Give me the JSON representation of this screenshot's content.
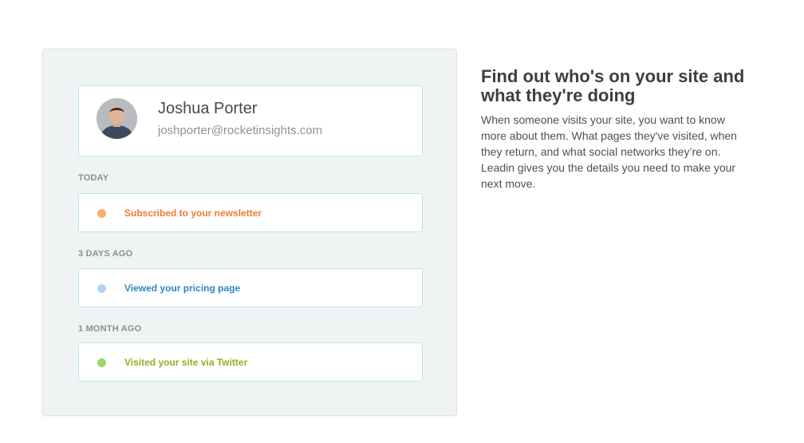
{
  "profile": {
    "name": "Joshua Porter",
    "email": "joshporter@rocketinsights.com"
  },
  "timeline": [
    {
      "label": "TODAY",
      "event": "Subscribed to your newsletter",
      "dot_color": "#f6b26b",
      "text_color": "#f07a2e"
    },
    {
      "label": "3 DAYS AGO",
      "event": "Viewed your pricing page",
      "dot_color": "#b4d3f2",
      "text_color": "#2a87c8"
    },
    {
      "label": "1 MONTH AGO",
      "event": "Visited your site via Twitter",
      "dot_color": "#9ed46a",
      "text_color": "#9aaa22"
    }
  ],
  "info": {
    "heading": "Find out who's on your site and what they're doing",
    "body": "When someone visits your site, you want to know more about them. What pages they've visited, when they return, and what social networks they’re on. Leadin gives you the details you need to make your next move."
  },
  "icons": {
    "avatar": "person-photo"
  }
}
